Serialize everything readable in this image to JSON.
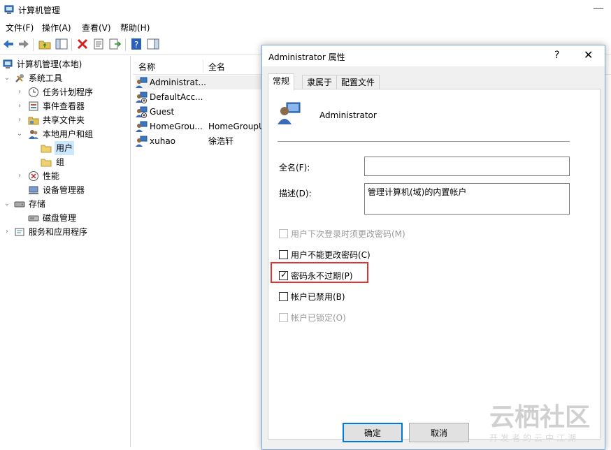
{
  "window": {
    "title": "计算机管理",
    "menu": [
      "文件(F)",
      "操作(A)",
      "查看(V)",
      "帮助(H)"
    ]
  },
  "tree": {
    "root": "计算机管理(本地)",
    "items": [
      {
        "label": "系统工具",
        "icon": "tools-icon"
      },
      {
        "label": "任务计划程序",
        "icon": "clock-icon"
      },
      {
        "label": "事件查看器",
        "icon": "event-log-icon"
      },
      {
        "label": "共享文件夹",
        "icon": "shared-folder-icon"
      },
      {
        "label": "本地用户和组",
        "icon": "users-icon"
      },
      {
        "label": "用户",
        "icon": "folder-icon"
      },
      {
        "label": "组",
        "icon": "folder-icon"
      },
      {
        "label": "性能",
        "icon": "performance-icon"
      },
      {
        "label": "设备管理器",
        "icon": "device-manager-icon"
      },
      {
        "label": "存储",
        "icon": "storage-icon"
      },
      {
        "label": "磁盘管理",
        "icon": "disk-icon"
      },
      {
        "label": "服务和应用程序",
        "icon": "services-icon"
      }
    ]
  },
  "list": {
    "columns": [
      "名称",
      "全名"
    ],
    "rows": [
      {
        "name": "Administrat...",
        "fullname": ""
      },
      {
        "name": "DefaultAcc...",
        "fullname": ""
      },
      {
        "name": "Guest",
        "fullname": ""
      },
      {
        "name": "HomeGrou...",
        "fullname": "HomeGroupU"
      },
      {
        "name": "xuhao",
        "fullname": "徐浩轩"
      }
    ]
  },
  "dialog": {
    "title": "Administrator 属性",
    "help": "?",
    "close": "✕",
    "tabs": [
      "常规",
      "隶属于",
      "配置文件"
    ],
    "user_name": "Administrator",
    "fullname_label": "全名(F):",
    "fullname_value": "",
    "description_label": "描述(D):",
    "description_value": "管理计算机(域)的内置帐户",
    "checkboxes": [
      {
        "label": "用户下次登录时须更改密码(M)",
        "checked": false,
        "disabled": true
      },
      {
        "label": "用户不能更改密码(C)",
        "checked": false,
        "disabled": false
      },
      {
        "label": "密码永不过期(P)",
        "checked": true,
        "disabled": false
      },
      {
        "label": "帐户已禁用(B)",
        "checked": false,
        "disabled": false
      },
      {
        "label": "帐户已锁定(O)",
        "checked": false,
        "disabled": true
      }
    ],
    "ok_label": "确定",
    "cancel_label": "取消"
  },
  "watermark": {
    "main": "云栖社区",
    "sub": "开发者的云中江湖"
  },
  "colors": {
    "selection": "#cce8ff",
    "highlight_box": "#e23232",
    "accent": "#0078d7"
  }
}
